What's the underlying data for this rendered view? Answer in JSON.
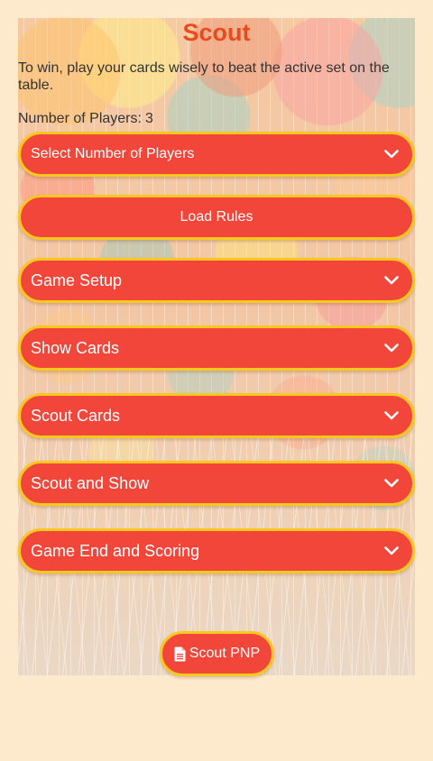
{
  "page": {
    "title": "Scout",
    "intro": "To win, play your cards wisely to beat the active set on the table.",
    "players_label": "Number of Players:",
    "players_value": "3"
  },
  "controls": {
    "select_players": {
      "label": "Select Number of Players",
      "icon": "chevron-down-icon"
    },
    "load_rules": {
      "label": "Load Rules"
    }
  },
  "sections": [
    {
      "label": "Game Setup",
      "icon": "chevron-down-icon"
    },
    {
      "label": "Show Cards",
      "icon": "chevron-down-icon"
    },
    {
      "label": "Scout Cards",
      "icon": "chevron-down-icon"
    },
    {
      "label": "Scout and Show",
      "icon": "chevron-down-icon"
    },
    {
      "label": "Game End and Scoring",
      "icon": "chevron-down-icon"
    }
  ],
  "footer": {
    "pnp_label": "Scout PNP",
    "pnp_icon": "file-icon"
  },
  "colors": {
    "page_background": "#fde9cc",
    "title": "#ea4a1c",
    "button_fill": "#f2463a",
    "button_border": "#f9c81f",
    "button_text": "#ffffff",
    "body_text": "#333333"
  }
}
